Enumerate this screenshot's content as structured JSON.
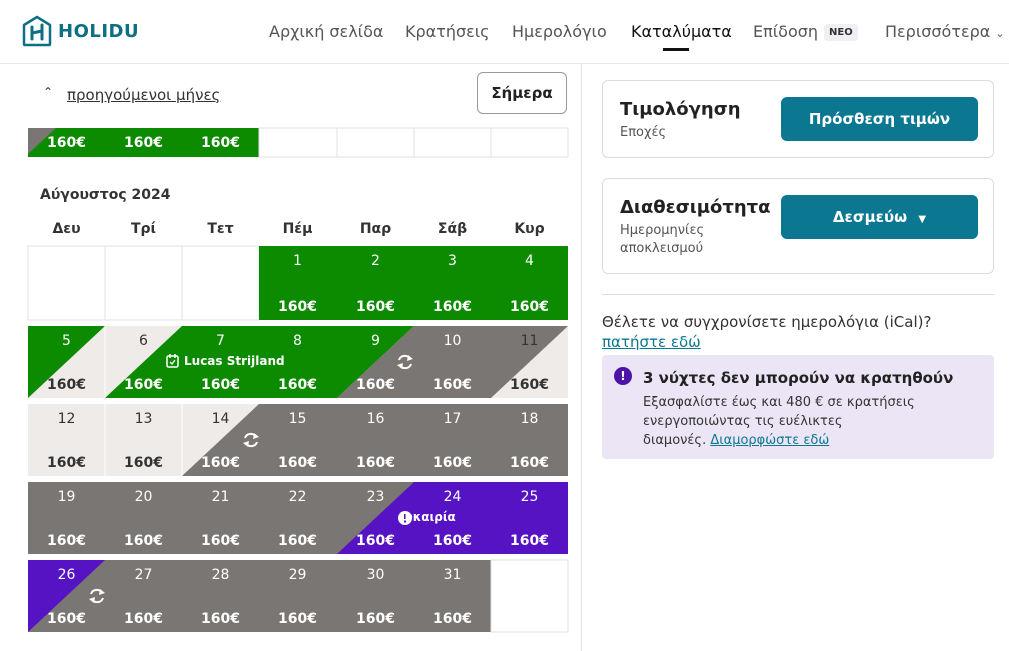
{
  "brand": {
    "name": "HOLIDU",
    "color": "#0c6f83"
  },
  "nav": {
    "home": "Αρχική σελίδα",
    "bookings": "Κρατήσεις",
    "calendar": "Ημερολόγιο",
    "properties": "Καταλύματα",
    "performance": "Επίδοση",
    "new_badge": "NEO",
    "more": "Περισσότερα",
    "active": "properties"
  },
  "calendar": {
    "prev_months_label": "προηγούμενοι μήνες",
    "today_button": "Σήμερα",
    "prev_strip_prices": [
      "160€",
      "160€",
      "160€"
    ],
    "month_title": "Αύγουστος 2024",
    "weekdays": [
      "Δευ",
      "Τρί",
      "Τετ",
      "Πέμ",
      "Παρ",
      "Σάβ",
      "Κυρ"
    ],
    "price": "160€",
    "booking_guest": "Lucas Strijland",
    "deal_label": "ευκαιρία",
    "colors": {
      "available": "#0c8a00",
      "blocked": "#7a7673",
      "past": "#eeebe8",
      "deal": "#5513c4",
      "empty": "#ffffff"
    }
  },
  "pricing_card": {
    "title": "Τιμολόγηση",
    "subtitle": "Εποχές",
    "button": "Πρόσθεση τιμών"
  },
  "availability_card": {
    "title": "Διαθεσιμότητα",
    "subtitle_line1": "Ημερομηνίες",
    "subtitle_line2": "αποκλεισμού",
    "button": "Δεσμεύω"
  },
  "ical": {
    "question": "Θέλετε να συγχρονίσετε ημερολόγια (iCal)?",
    "link": "πατήστε εδώ"
  },
  "alert": {
    "title": "3 νύχτες δεν μπορούν να κρατηθούν",
    "line1": "Εξασφαλίστε έως και 480 € σε κρατήσεις",
    "line2": "ενεργοποιώντας τις ευέλικτες",
    "line3": "διαμονές.",
    "link": "Διαμορφώστε εδώ"
  }
}
